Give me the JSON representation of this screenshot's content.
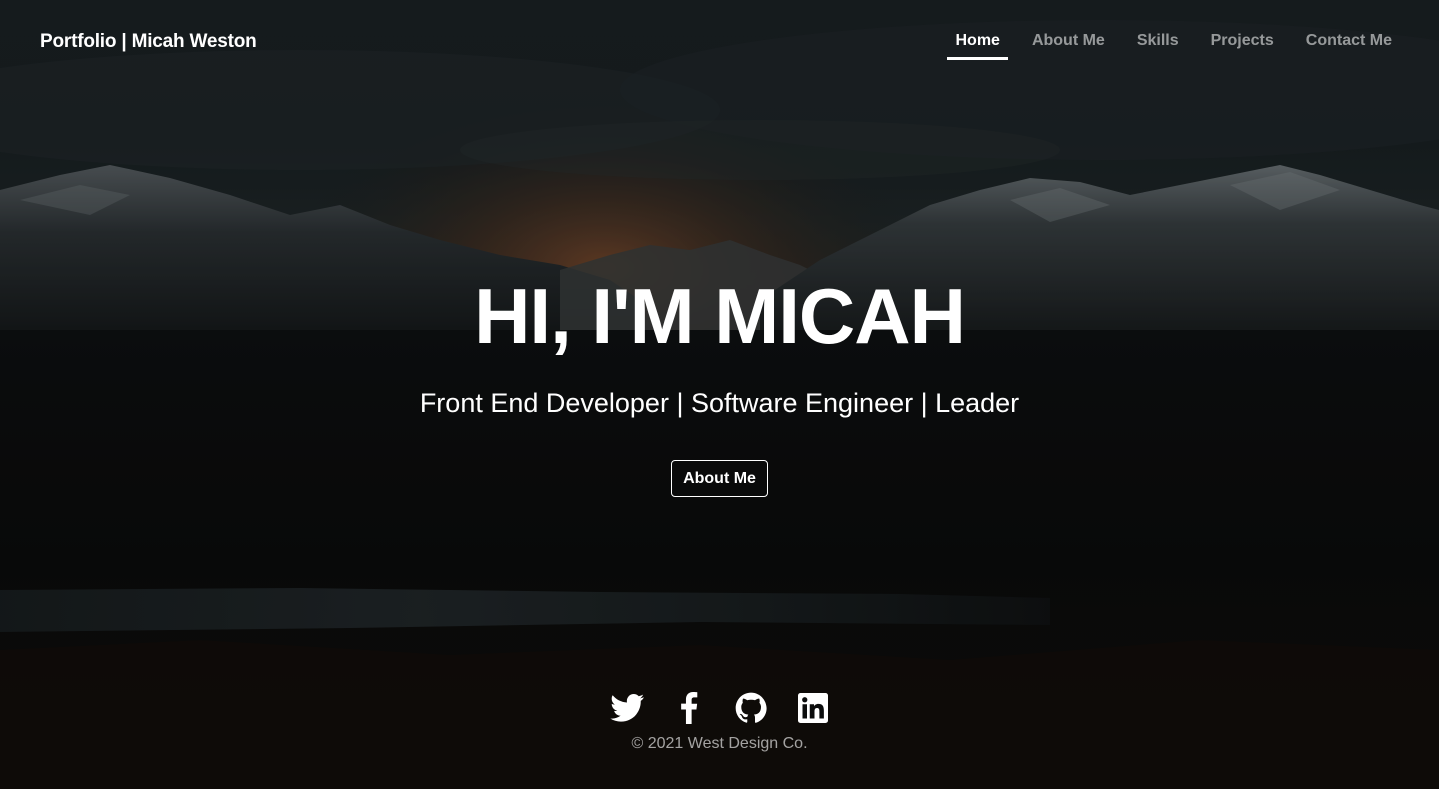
{
  "navbar": {
    "brand": "Portfolio | Micah Weston",
    "links": [
      {
        "label": "Home",
        "active": true
      },
      {
        "label": "About Me",
        "active": false
      },
      {
        "label": "Skills",
        "active": false
      },
      {
        "label": "Projects",
        "active": false
      },
      {
        "label": "Contact Me",
        "active": false
      }
    ]
  },
  "hero": {
    "title": "HI, I'M MICAH",
    "subtitle": "Front End Developer | Software Engineer | Leader",
    "button_label": "About Me"
  },
  "footer": {
    "socials": [
      "twitter-icon",
      "facebook-icon",
      "github-icon",
      "linkedin-icon"
    ],
    "copyright": "© 2021 West Design Co."
  },
  "colors": {
    "text": "#ffffff",
    "muted_nav": "#8c8f91",
    "background": "#07090a"
  }
}
